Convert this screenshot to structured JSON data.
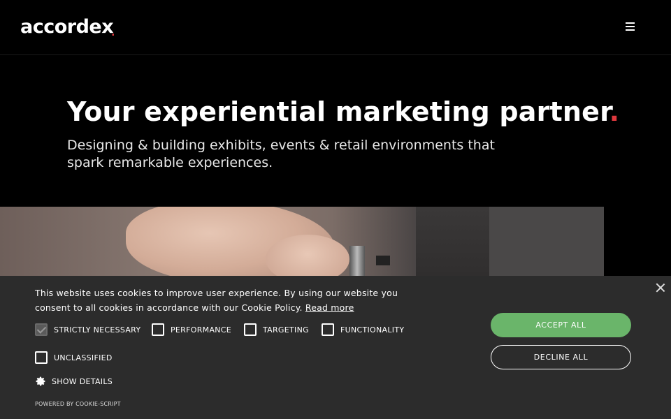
{
  "header": {
    "logo_text": "accordex",
    "logo_accent": ".",
    "menu_icon": "hamburger-menu-icon"
  },
  "hero": {
    "title": "Your experiential marketing partner",
    "title_accent": ".",
    "subtitle": "Designing & building exhibits, events & retail environments that spark remarkable experiences."
  },
  "cookie_banner": {
    "text": "This website uses cookies to improve user experience. By using our website you consent to all cookies in accordance with our Cookie Policy.",
    "read_more": "Read more",
    "categories": [
      {
        "label": "STRICTLY NECESSARY",
        "checked": true
      },
      {
        "label": "PERFORMANCE",
        "checked": false
      },
      {
        "label": "TARGETING",
        "checked": false
      },
      {
        "label": "FUNCTIONALITY",
        "checked": false
      },
      {
        "label": "UNCLASSIFIED",
        "checked": false
      }
    ],
    "show_details": "SHOW DETAILS",
    "powered_by": "POWERED BY COOKIE-SCRIPT",
    "accept_all": "ACCEPT ALL",
    "decline_all": "DECLINE ALL"
  },
  "colors": {
    "accent_red": "#e0393e",
    "accept_green": "#6ab56a",
    "banner_bg": "#2c2c2c"
  }
}
